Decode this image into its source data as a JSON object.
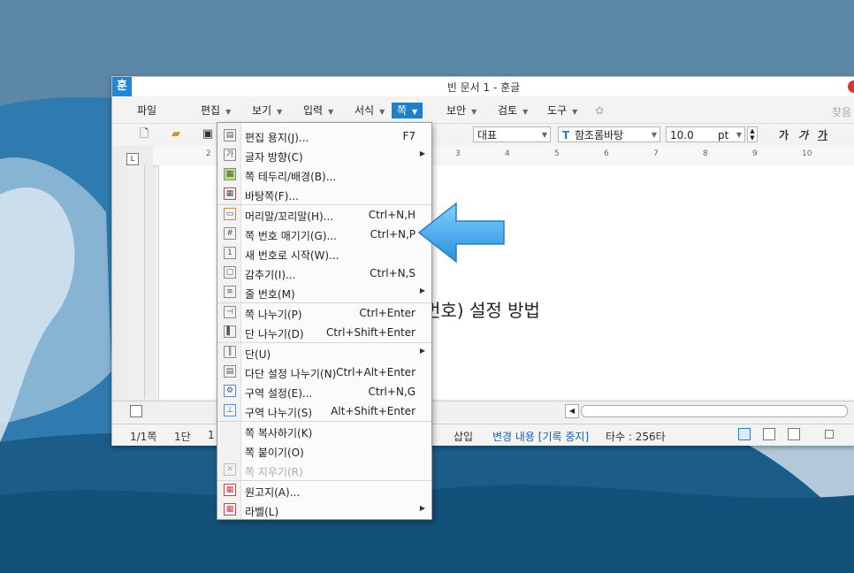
{
  "window": {
    "title": "빈 문서 1 - 훈글",
    "logo": "훈"
  },
  "menubar": {
    "items": [
      {
        "label": "파일"
      },
      {
        "label": "편집"
      },
      {
        "label": "보기"
      },
      {
        "label": "입력"
      },
      {
        "label": "서식"
      },
      {
        "label": "쪽"
      },
      {
        "label": "보안"
      },
      {
        "label": "검토"
      },
      {
        "label": "도구"
      }
    ],
    "right_text": "찾음"
  },
  "toolbar": {
    "style_combo": "대표",
    "font_combo": "함조롬바탕",
    "size_value": "10.0",
    "size_unit": "pt",
    "bold": "가",
    "italic": "가",
    "underline": "가"
  },
  "ruler": {
    "numbers": [
      "2",
      "3",
      "4",
      "5",
      "6",
      "7",
      "8",
      "9",
      "10"
    ]
  },
  "document": {
    "text": "번호) 설정 방법"
  },
  "statusbar": {
    "page": "1/1쪽",
    "column": "1단",
    "line": "1",
    "insert_mode": "삽입",
    "track_changes": "변경 내용 [기록 중지]",
    "keystrokes": "타수 : 256타"
  },
  "dropdown": {
    "items": [
      {
        "label": "편집 용지(J)...",
        "shortcut": "F7",
        "icon": "page-setup-icon"
      },
      {
        "label": "글자 방향(C)",
        "shortcut": "",
        "submenu": true,
        "icon": "text-direction-icon"
      },
      {
        "label": "쪽 테두리/배경(B)...",
        "shortcut": "",
        "icon": "page-border-icon"
      },
      {
        "label": "바탕쪽(F)...",
        "shortcut": "",
        "icon": "master-page-icon"
      },
      {
        "label": "머리말/꼬리말(H)...",
        "shortcut": "Ctrl+N,H",
        "icon": "header-footer-icon"
      },
      {
        "label": "쪽 번호 매기기(G)...",
        "shortcut": "Ctrl+N,P",
        "icon": "page-number-icon"
      },
      {
        "label": "새 번호로 시작(W)...",
        "shortcut": "",
        "icon": "new-number-icon"
      },
      {
        "label": "감추기(I)...",
        "shortcut": "Ctrl+N,S",
        "icon": "hide-icon"
      },
      {
        "label": "줄 번호(M)",
        "shortcut": "",
        "submenu": true,
        "icon": "line-number-icon"
      },
      {
        "label": "쪽 나누기(P)",
        "shortcut": "Ctrl+Enter",
        "icon": "page-break-icon"
      },
      {
        "label": "단 나누기(D)",
        "shortcut": "Ctrl+Shift+Enter",
        "icon": "column-break-icon"
      },
      {
        "label": "단(U)",
        "shortcut": "",
        "submenu": true,
        "icon": "columns-icon"
      },
      {
        "label": "다단 설정 나누기(N)",
        "shortcut": "Ctrl+Alt+Enter",
        "icon": "multi-column-break-icon"
      },
      {
        "label": "구역 설정(E)...",
        "shortcut": "Ctrl+N,G",
        "icon": "section-setup-icon"
      },
      {
        "label": "구역 나누기(S)",
        "shortcut": "Alt+Shift+Enter",
        "icon": "section-break-icon"
      },
      {
        "label": "쪽 복사하기(K)",
        "shortcut": "",
        "icon": ""
      },
      {
        "label": "쪽 붙이기(O)",
        "shortcut": "",
        "icon": ""
      },
      {
        "label": "쪽 지우기(R)",
        "shortcut": "",
        "disabled": true,
        "icon": "delete-page-icon"
      },
      {
        "label": "원고지(A)...",
        "shortcut": "",
        "icon": "manuscript-icon"
      },
      {
        "label": "라벨(L)",
        "shortcut": "",
        "submenu": true,
        "icon": "label-icon"
      }
    ]
  },
  "colors": {
    "accent": "#1f7fc9",
    "arrow": "#4aaee8"
  }
}
